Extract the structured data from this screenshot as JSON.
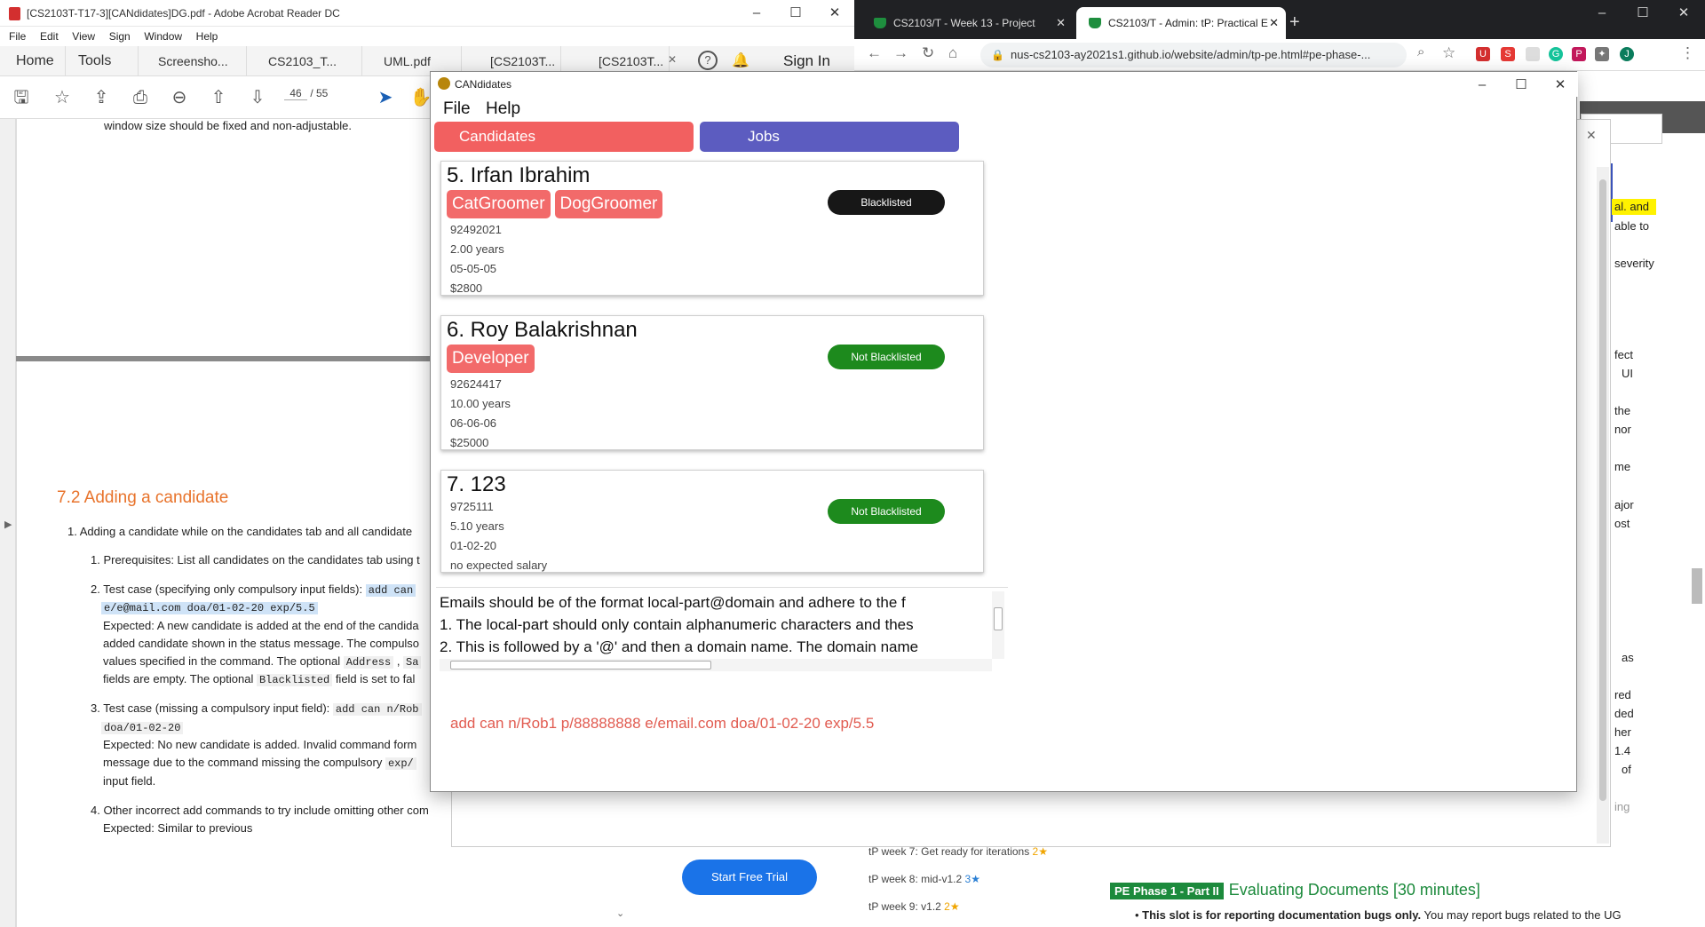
{
  "acrobat": {
    "title": "[CS2103T-T17-3][CANdidates]DG.pdf - Adobe Acrobat Reader DC",
    "menu": [
      "File",
      "Edit",
      "View",
      "Sign",
      "Window",
      "Help"
    ],
    "tabs": [
      "Home",
      "Tools",
      "Screensho...",
      "CS2103_T...",
      "UML.pdf",
      "[CS2103T...",
      "[CS2103T..."
    ],
    "sign_in": "Sign In",
    "page_current": "46",
    "page_total": "/ 55",
    "doc": {
      "line_top": "window size should be fixed and non-adjustable.",
      "heading": "7.2 Adding a candidate",
      "item1": "1. Adding a candidate while on the candidates tab and all candidate",
      "item1_1": "1. Prerequisites: List all candidates on the candidates tab using t",
      "item1_2a": "2. Test case (specifying only compulsory input fields):",
      "item1_2a_code": "add can",
      "item1_2b_code": "e/e@mail.com doa/01-02-20 exp/5.5",
      "item1_2c": "Expected: A new candidate is added at the end of the candida",
      "item1_2d": "added candidate shown in the status message. The compulso",
      "item1_2e": "values specified in the command. The optional",
      "item1_2e_code1": "Address",
      "item1_2e_code2": "Sa",
      "item1_2f": "fields are empty. The optional",
      "item1_2f_code": "Blacklisted",
      "item1_2f_tail": "field is set to fal",
      "item1_3a": "3. Test case (missing a compulsory input field):",
      "item1_3a_code": "add can n/Rob",
      "item1_3b_code": "doa/01-02-20",
      "item1_3c": "Expected: No new candidate is added. Invalid command form",
      "item1_3d": "message due to the command missing the compulsory",
      "item1_3d_code": "exp/",
      "item1_3e": "input field.",
      "item1_4a": "4. Other incorrect add commands to try include omitting other com",
      "item1_4b": "Expected: Similar to previous"
    }
  },
  "chrome": {
    "tabs": [
      {
        "title": "CS2103/T - Week 13 - Project",
        "active": false
      },
      {
        "title": "CS2103/T - Admin: tP: Practical E",
        "active": true
      }
    ],
    "url": "nus-cs2103-ay2021s1.github.io/website/admin/tp-pe.html#pe-phase-...",
    "right_snippets": [
      "al. and",
      "able to",
      "severity",
      "fect",
      "UI",
      "the",
      "nor",
      "me",
      "ajor",
      "ost",
      "as",
      "red",
      "ded",
      "her",
      "1.4",
      "of",
      "ing"
    ],
    "start_trial": "Start Free Trial",
    "weeks": [
      {
        "label": "tP week 7: Get ready for iterations",
        "stars": "2★",
        "star_color": "gold"
      },
      {
        "label": "tP week 8: mid-v1.2",
        "stars": "3★",
        "star_color": "blue"
      },
      {
        "label": "tP week 9: v1.2",
        "stars": "2★",
        "star_color": "gold"
      }
    ],
    "pe_badge": "PE Phase 1 - Part II",
    "pe_title": "Evaluating Documents [30 minutes]",
    "pe_note_bold": "This slot is for reporting documentation bugs only.",
    "pe_note_rest": " You may report bugs related to the UG"
  },
  "app": {
    "title": "CANdidates",
    "menu": [
      "File",
      "Help"
    ],
    "tabs": {
      "candidates": "Candidates",
      "jobs": "Jobs"
    },
    "candidates": [
      {
        "name": "5.  Irfan Ibrahim",
        "tags": [
          "CatGroomer",
          "DogGroomer"
        ],
        "phone": "92492021",
        "experience": "2.00 years",
        "date": "05-05-05",
        "salary": "$2800",
        "status": "Blacklisted"
      },
      {
        "name": "6.  Roy Balakrishnan",
        "tags": [
          "Developer"
        ],
        "phone": "92624417",
        "experience": "10.00 years",
        "date": "06-06-06",
        "salary": "$25000",
        "status": "Not Blacklisted"
      },
      {
        "name": "7.  123",
        "tags": [],
        "phone": "9725111",
        "experience": "5.10 years",
        "date": "01-02-20",
        "salary": "no expected salary",
        "status": "Not Blacklisted"
      }
    ],
    "result_lines": [
      "Emails should be of the format local-part@domain and adhere to the f",
      "1. The local-part should only contain alphanumeric characters and thes",
      "2. This is followed by a '@' and then a domain name. The domain name"
    ],
    "command": "add can n/Rob1 p/88888888 e/email.com doa/01-02-20 exp/5.5"
  }
}
